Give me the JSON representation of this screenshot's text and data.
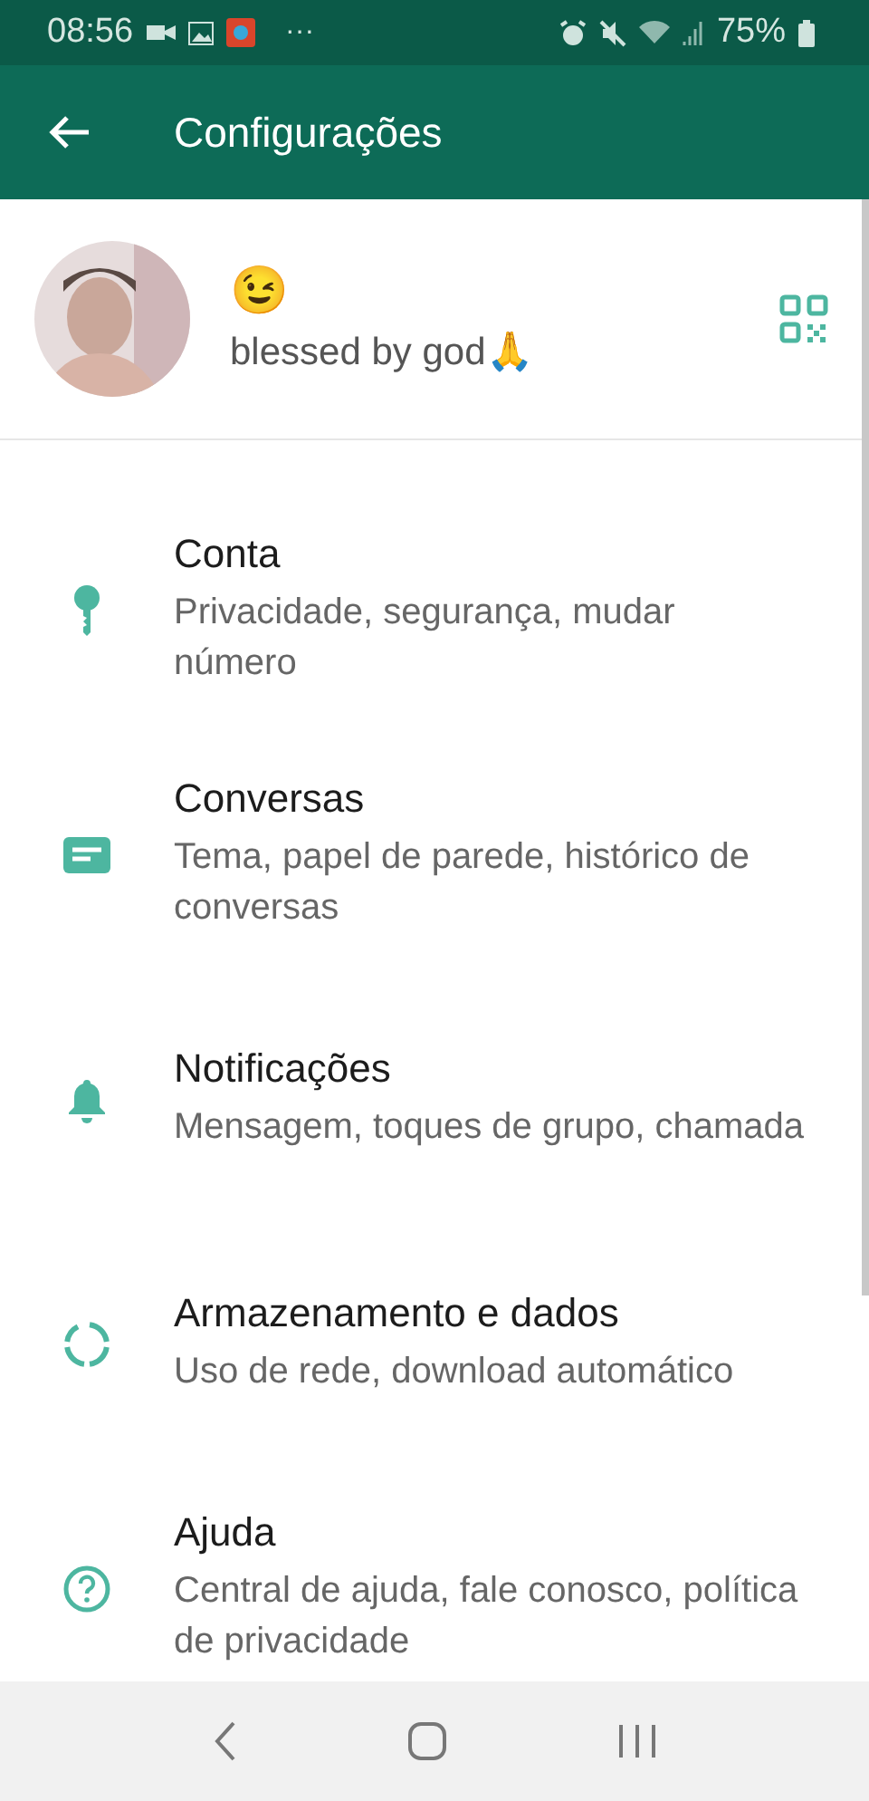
{
  "status_bar": {
    "time": "08:56",
    "more": "···",
    "battery": "75%"
  },
  "app_bar": {
    "title": "Configurações"
  },
  "profile": {
    "name": "😉",
    "about": "blessed by god🙏"
  },
  "settings": [
    {
      "kind": "key",
      "title": "Conta",
      "subtitle": "Privacidade, segurança, mudar número"
    },
    {
      "kind": "chat",
      "title": "Conversas",
      "subtitle": "Tema, papel de parede, histórico de conversas"
    },
    {
      "kind": "bell",
      "title": "Notificações",
      "subtitle": "Mensagem, toques de grupo, chamada"
    },
    {
      "kind": "storage",
      "title": "Armazenamento e dados",
      "subtitle": "Uso de rede, download automático"
    },
    {
      "kind": "help",
      "title": "Ajuda",
      "subtitle": "Central de ajuda, fale conosco, política de privacidade"
    }
  ]
}
